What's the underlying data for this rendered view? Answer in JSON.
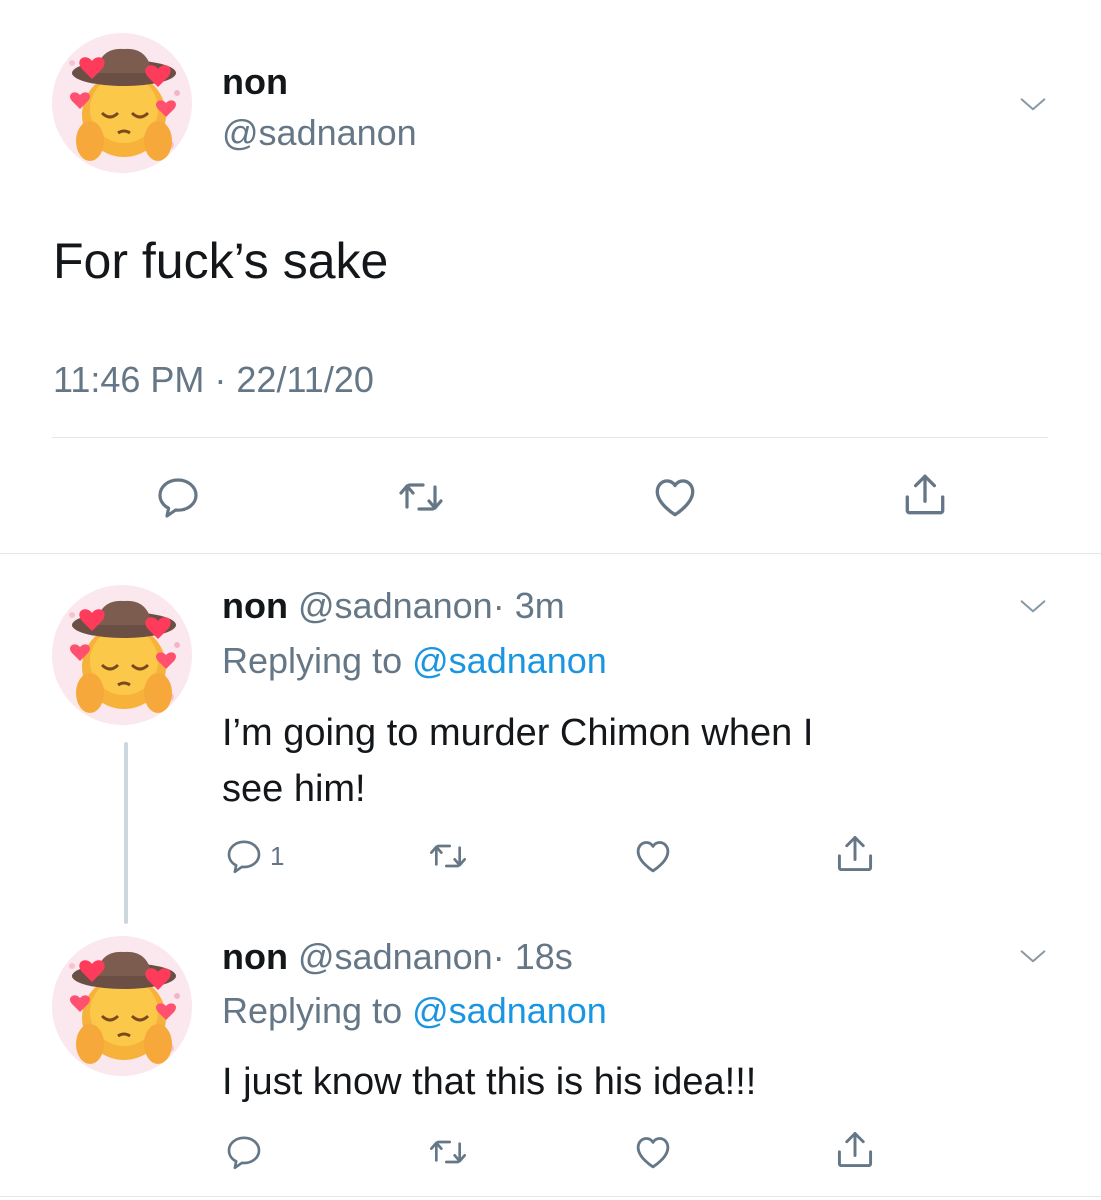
{
  "main_tweet": {
    "name": "non",
    "handle": "@sadnanon",
    "text": "For fuck’s sake",
    "timestamp": "11:46 PM · 22/11/20",
    "avatar_icon": "emoji-pleading-face-cowboy-hat-hearts-icon"
  },
  "replies": [
    {
      "name": "non",
      "handle": "@sadnanon",
      "time": "· 3m",
      "replying_prefix": "Replying to",
      "replying_to": "@sadnanon",
      "text_line1": "I’m going to murder Chimon when I",
      "text_line2": "see him!",
      "reply_count": "1"
    },
    {
      "name": "non",
      "handle": "@sadnanon",
      "time": "· 18s",
      "replying_prefix": "Replying to",
      "replying_to": "@sadnanon",
      "text_line1": "I just know that this is his idea!!!",
      "reply_count": ""
    }
  ],
  "icons": {
    "reply": "reply-icon",
    "retweet": "retweet-icon",
    "like": "heart-icon",
    "share": "share-icon",
    "menu": "chevron-down-icon"
  },
  "colors": {
    "text": "#14171a",
    "secondary": "#657786",
    "link": "#1b95e0",
    "divider": "#e1e8ed",
    "thread_line": "#ccd6dd"
  }
}
